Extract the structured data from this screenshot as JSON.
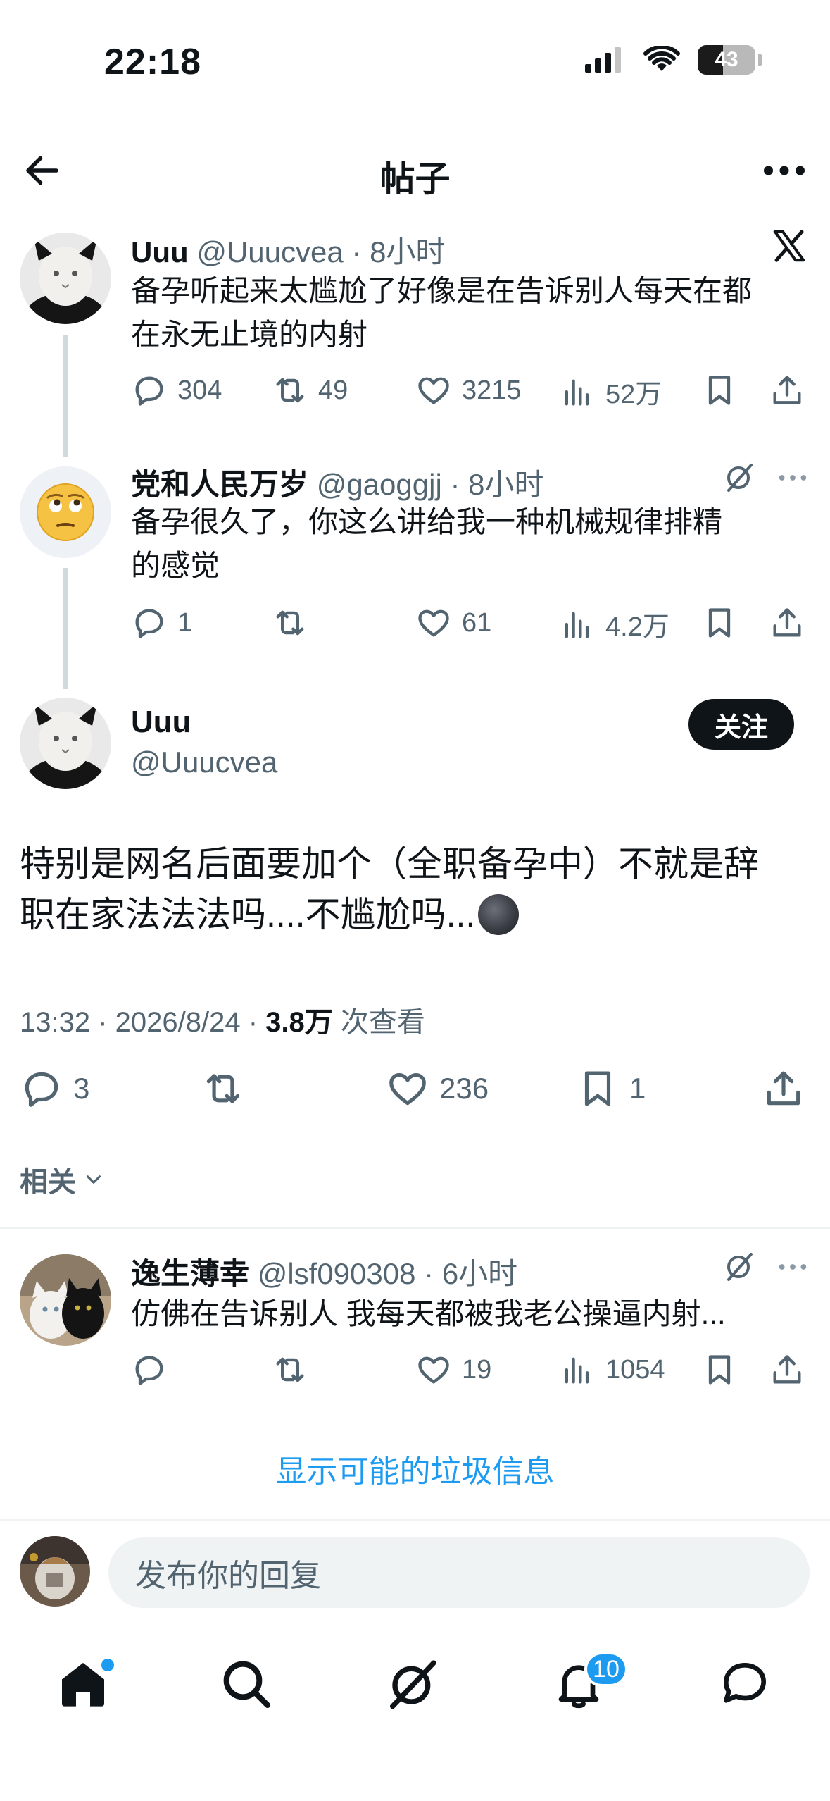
{
  "status_bar": {
    "time": "22:18",
    "battery": "43"
  },
  "header": {
    "title": "帖子"
  },
  "thread": [
    {
      "name": "Uuu",
      "handle": "@Uuucvea",
      "time": "8小时",
      "text_line1": "备孕听起来太尴尬了好像是在告诉别人每天在都",
      "text_line2": "在永无止境的内射",
      "replies": "304",
      "reposts": "49",
      "likes": "3215",
      "views": "52万"
    },
    {
      "name": "党和人民万岁",
      "handle": "@gaoggjj",
      "time": "8小时",
      "text_line1": "备孕很久了，你这么讲给我一种机械规律排精",
      "text_line2": "的感觉",
      "replies": "1",
      "reposts": "",
      "likes": "61",
      "views": "4.2万"
    }
  ],
  "main_post": {
    "name": "Uuu",
    "handle": "@Uuucvea",
    "follow_label": "关注",
    "text_line1": "特别是网名后面要加个（全职备孕中）不就是辞",
    "text_line2": "职在家法法法吗....不尴尬吗...",
    "timestamp": "13:32 · 2026/8/24 · ",
    "view_count": "3.8万",
    "view_suffix": " 次查看",
    "replies": "3",
    "likes": "236",
    "bookmarks": "1",
    "related_label": "相关"
  },
  "reply_post": {
    "name": "逸生薄幸",
    "handle": "@lsf090308",
    "time": "6小时",
    "text": "仿佛在告诉别人 我每天都被我老公操逼内射...",
    "replies": "",
    "reposts": "",
    "likes": "19",
    "views": "1054"
  },
  "spam_link": "显示可能的垃圾信息",
  "reply_bar": {
    "placeholder": "发布你的回复"
  },
  "tabbar": {
    "notifications_badge": "10"
  },
  "colors": {
    "accent": "#1d9bf0",
    "text": "#0f1419",
    "muted": "#536471"
  }
}
